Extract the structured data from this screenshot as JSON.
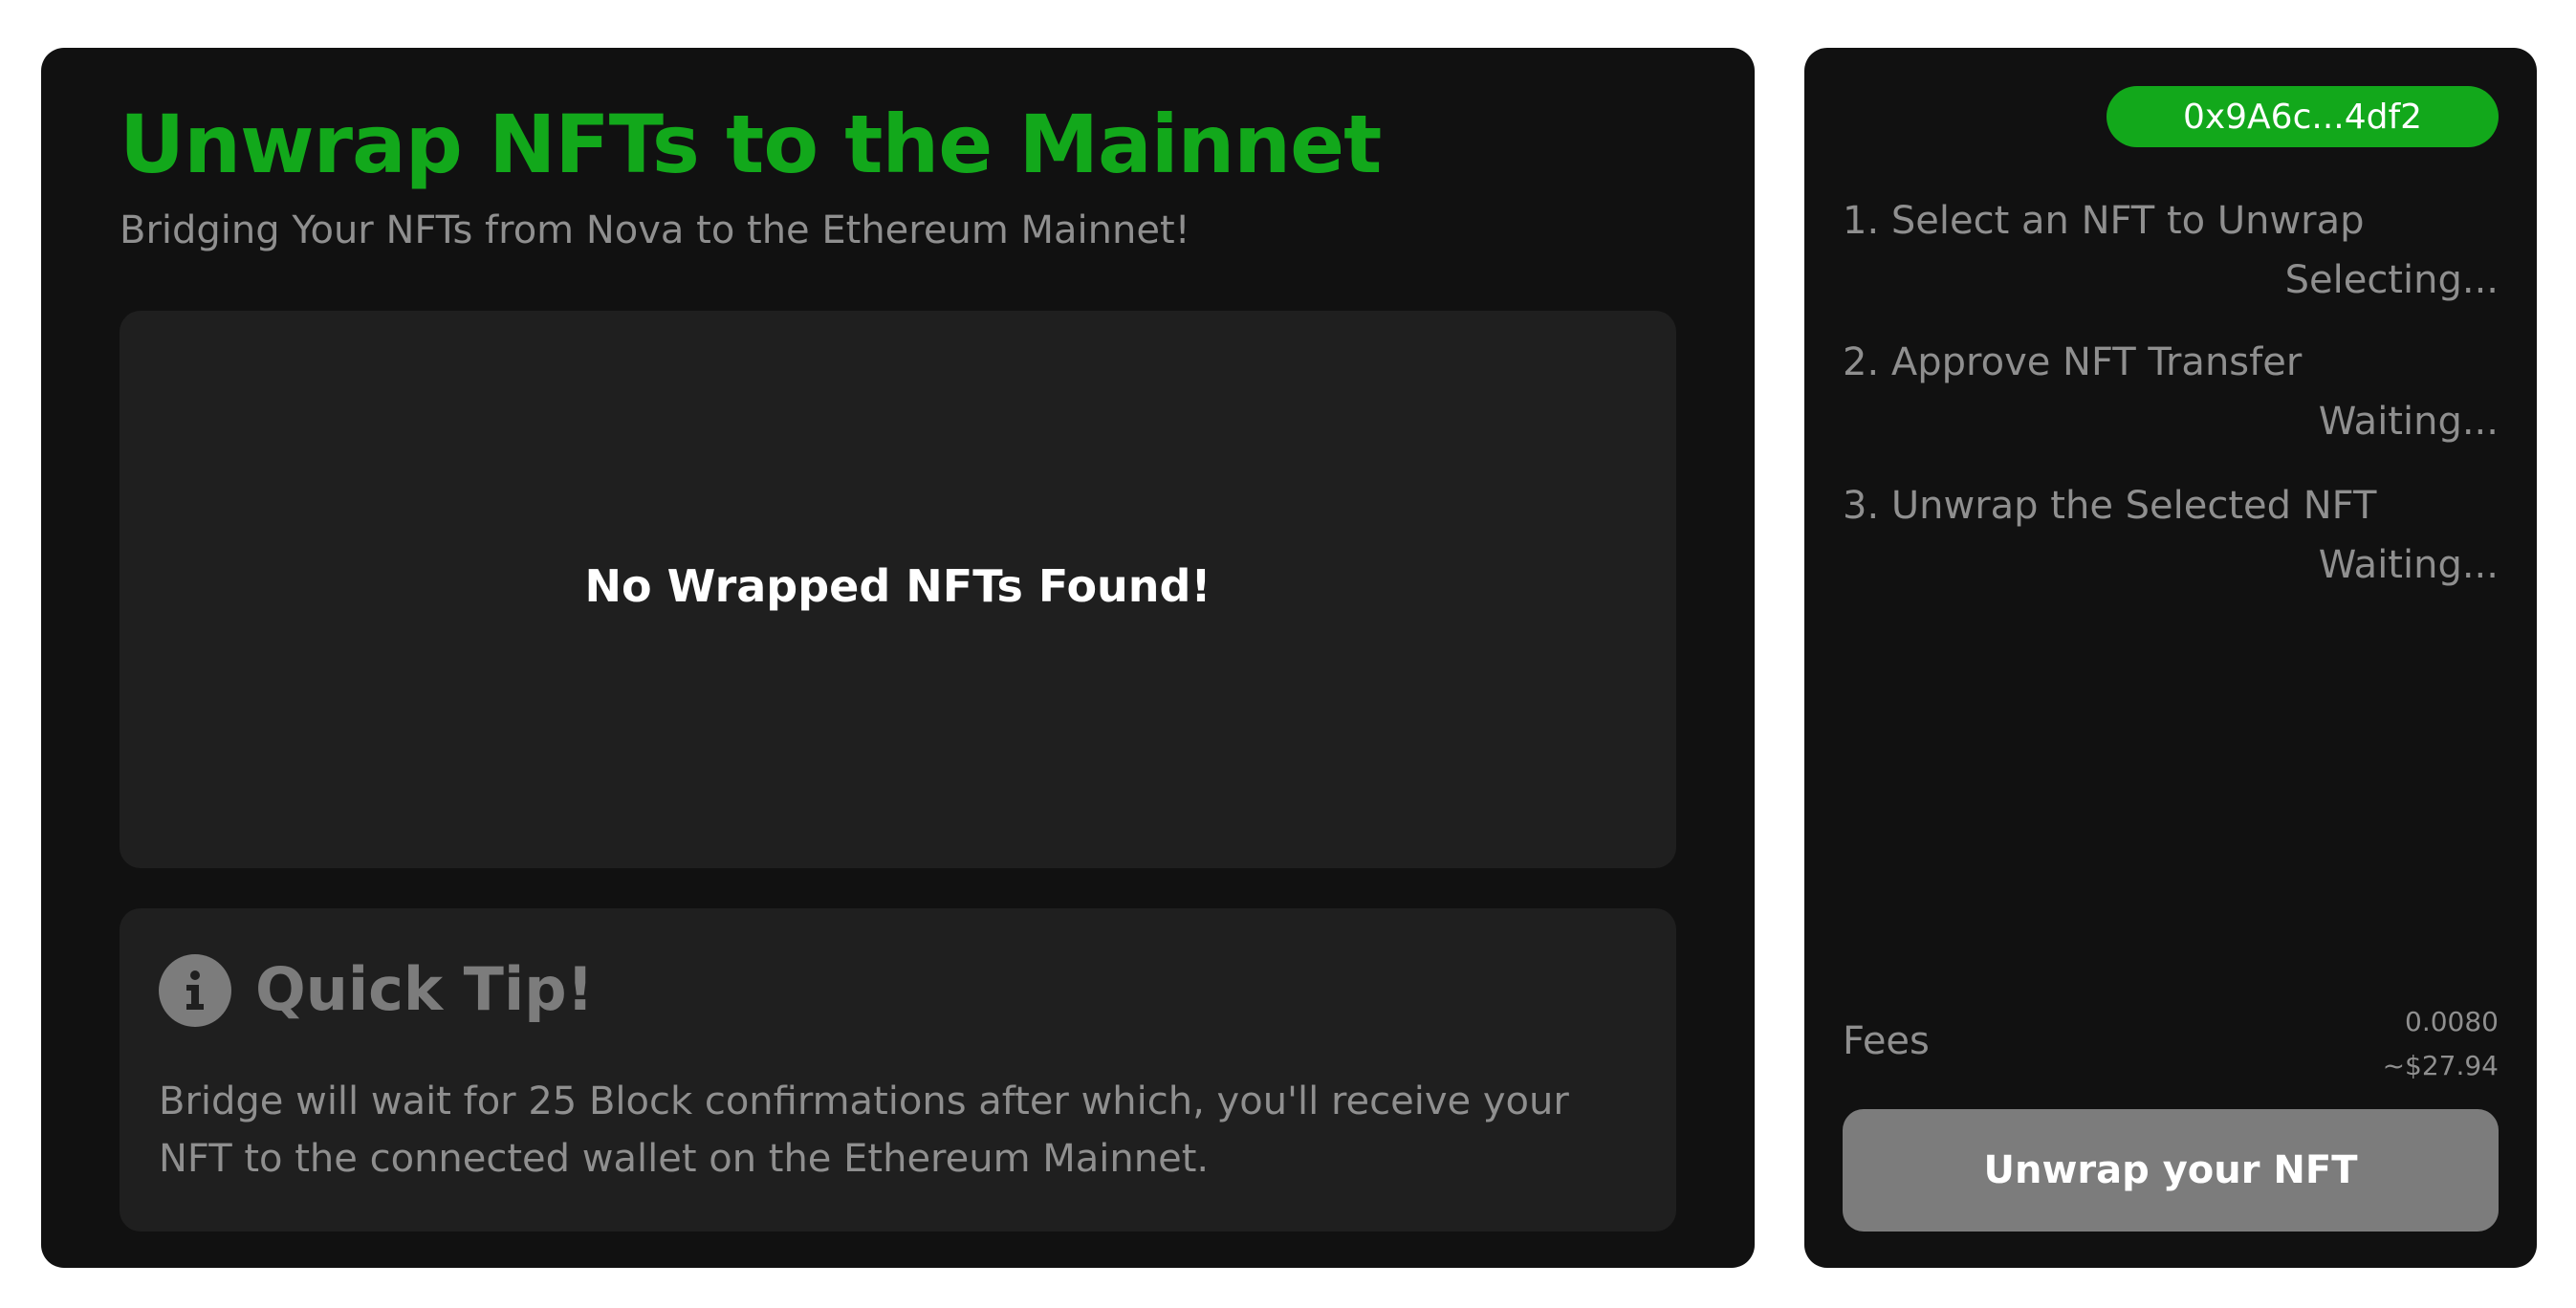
{
  "header": {
    "title": "Unwrap NFTs to the Mainnet",
    "subtitle": "Bridging Your NFTs from Nova to the Ethereum Mainnet!"
  },
  "nft_list": {
    "empty_message": "No Wrapped NFTs Found!"
  },
  "tip": {
    "icon": "info-icon",
    "title": "Quick Tip!",
    "body": "Bridge will wait for 25 Block confirmations after which, you'll receive your NFT to the connected wallet on the Ethereum Mainnet."
  },
  "wallet": {
    "address": "0x9A6c...4df2"
  },
  "steps": [
    {
      "label": "1. Select an NFT to Unwrap",
      "status": "Selecting..."
    },
    {
      "label": "2. Approve NFT Transfer",
      "status": "Waiting..."
    },
    {
      "label": "3. Unwrap the Selected NFT",
      "status": "Waiting..."
    }
  ],
  "fees": {
    "label": "Fees",
    "amount": "0.0080",
    "usd": "~$27.94"
  },
  "action": {
    "button_label": "Unwrap your NFT"
  },
  "colors": {
    "accent": "#12a81b",
    "panel": "#111111",
    "card": "#1f1f1f",
    "muted": "#8f8f8f",
    "disabled_button": "#7c7c7c"
  }
}
